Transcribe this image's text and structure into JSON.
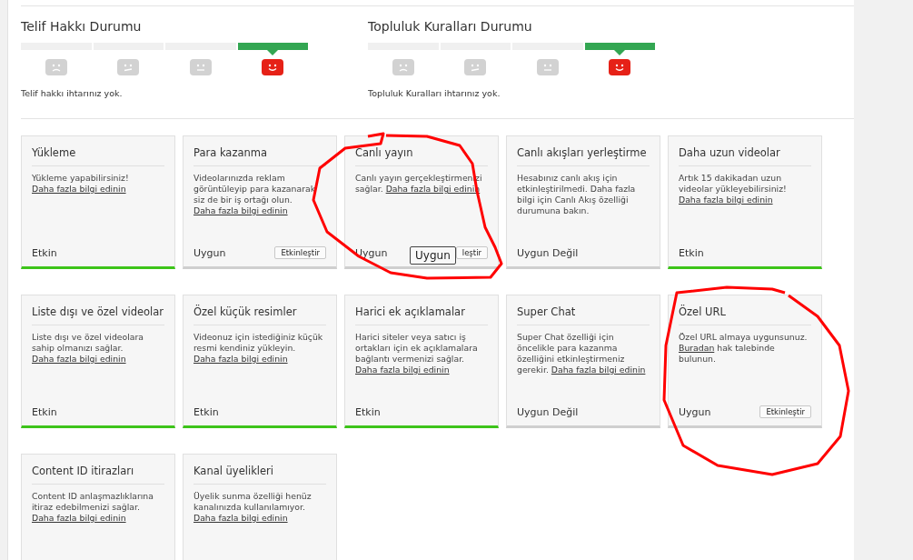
{
  "status_panels": [
    {
      "title": "Telif Hakkı Durumu",
      "message": "Telif hakkı ihtarınız yok.",
      "levels": [
        {
          "kind": "sad",
          "selected": false
        },
        {
          "kind": "unsure",
          "selected": false
        },
        {
          "kind": "neutral",
          "selected": false
        },
        {
          "kind": "happy",
          "selected": true
        }
      ]
    },
    {
      "title": "Topluluk Kuralları Durumu",
      "message": "Topluluk Kuralları ihtarınız yok.",
      "levels": [
        {
          "kind": "sad",
          "selected": false
        },
        {
          "kind": "unsure",
          "selected": false
        },
        {
          "kind": "neutral",
          "selected": false
        },
        {
          "kind": "happy",
          "selected": true
        }
      ]
    }
  ],
  "features": [
    {
      "title": "Yükleme",
      "description": [
        {
          "kind": "text",
          "text": "Yükleme yapabilirsiniz!"
        },
        {
          "kind": "link",
          "text": "Daha fazla bilgi edinin"
        }
      ],
      "status": "Etkin",
      "enabled": true
    },
    {
      "title": "Para kazanma",
      "description": [
        {
          "kind": "text",
          "text": "Videolarınızda reklam görüntüleyip para kazanarak siz de bir iş ortağı olun."
        },
        {
          "kind": "link",
          "text": "Daha fazla bilgi edinin"
        }
      ],
      "status": "Uygun",
      "enabled": false,
      "button": "Etkinleştir"
    },
    {
      "title": "Canlı yayın",
      "description": [
        {
          "kind": "text",
          "text": "Canlı yayın gerçekleştirmenizi sağlar."
        },
        {
          "kind": "link",
          "text": "Daha fazla bilgi edinin"
        }
      ],
      "status": "Uygun",
      "enabled": false,
      "annotation_label": "Uygun",
      "button": "leştir"
    },
    {
      "title": "Canlı akışları yerleştirme",
      "description": [
        {
          "kind": "text",
          "text": "Hesabınız canlı akış için etkinleştirilmedi. Daha fazla bilgi için Canlı Akış özelliği durumuna bakın."
        }
      ],
      "status": "Uygun Değil",
      "enabled": false
    },
    {
      "title": "Daha uzun videolar",
      "description": [
        {
          "kind": "text",
          "text": "Artık 15 dakikadan uzun videolar yükleyebilirsiniz!"
        },
        {
          "kind": "link",
          "text": "Daha fazla bilgi edinin"
        }
      ],
      "status": "Etkin",
      "enabled": true
    },
    {
      "title": "Liste dışı ve özel videolar",
      "description": [
        {
          "kind": "text",
          "text": "Liste dışı ve özel videolara sahip olmanızı sağlar."
        },
        {
          "kind": "link",
          "text": "Daha fazla bilgi edinin"
        }
      ],
      "status": "Etkin",
      "enabled": true
    },
    {
      "title": "Özel küçük resimler",
      "description": [
        {
          "kind": "text",
          "text": "Videonuz için istediğiniz küçük resmi kendiniz yükleyin."
        },
        {
          "kind": "link",
          "text": "Daha fazla bilgi edinin"
        }
      ],
      "status": "Etkin",
      "enabled": true
    },
    {
      "title": "Harici ek açıklamalar",
      "description": [
        {
          "kind": "text",
          "text": "Harici siteler veya satıcı iş ortakları için ek açıklamalara bağlantı vermenizi sağlar."
        },
        {
          "kind": "link",
          "text": "Daha fazla bilgi edinin"
        }
      ],
      "status": "Etkin",
      "enabled": true
    },
    {
      "title": "Super Chat",
      "description": [
        {
          "kind": "text",
          "text": "Super Chat özelliği için öncelikle para kazanma özelliğini etkinleştirmeniz gerekir."
        },
        {
          "kind": "link",
          "text": "Daha fazla bilgi edinin"
        }
      ],
      "status": "Uygun Değil",
      "enabled": false
    },
    {
      "title": "Özel URL",
      "description": [
        {
          "kind": "text",
          "text": "Özel URL almaya uygunsunuz."
        },
        {
          "kind": "link",
          "text": "Buradan"
        },
        {
          "kind": "text",
          "text": "hak talebinde bulunun."
        }
      ],
      "status": "Uygun",
      "enabled": false,
      "button": "Etkinleştir"
    },
    {
      "title": "Content ID itirazları",
      "description": [
        {
          "kind": "text",
          "text": "Content ID anlaşmazlıklarına itiraz edebilmenizi sağlar."
        },
        {
          "kind": "link",
          "text": "Daha fazla bilgi edinin"
        }
      ]
    },
    {
      "title": "Kanal üyelikleri",
      "description": [
        {
          "kind": "text",
          "text": "Üyelik sunma özelliği henüz kanalınızda kullanılamıyor."
        },
        {
          "kind": "link",
          "text": "Daha fazla bilgi edinin"
        }
      ]
    }
  ],
  "annotations": [
    {
      "kind": "loop"
    },
    {
      "kind": "loop"
    }
  ]
}
